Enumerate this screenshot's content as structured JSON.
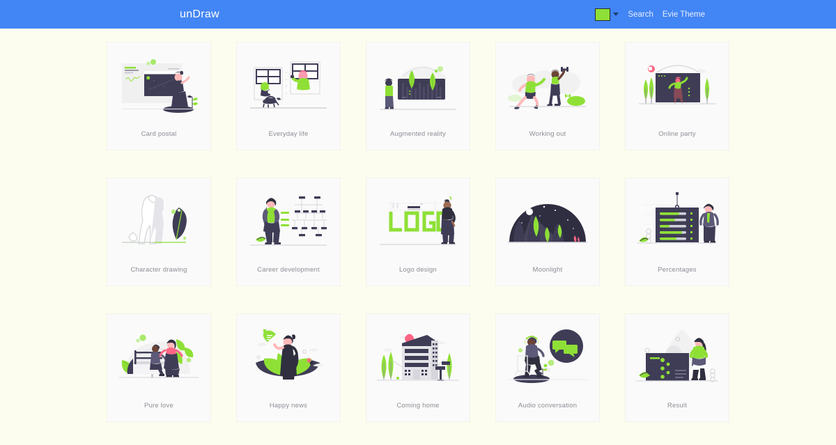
{
  "header": {
    "brand": "unDraw",
    "color_swatch": "#8FE036",
    "caret_icon": "chevron-down-icon",
    "links": [
      {
        "label": "Search",
        "name": "search-link"
      },
      {
        "label": "Evie Theme",
        "name": "evie-theme-link"
      }
    ]
  },
  "theme": {
    "page_background": "#FDFDEF",
    "card_background": "#FAFAFA",
    "accent_green": "#8FE036",
    "dark_navy": "#3F3D56",
    "brand_blue": "#4285F4",
    "label_text": "#8D8D96",
    "skin_light": "#FFB9B9",
    "accent_red": "#FF6584"
  },
  "gallery": {
    "columns": 5,
    "items": [
      {
        "id": "card-postal",
        "label": "Card postal"
      },
      {
        "id": "everyday-life",
        "label": "Everyday life"
      },
      {
        "id": "augmented-reality",
        "label": "Augmented reality"
      },
      {
        "id": "working-out",
        "label": "Working out"
      },
      {
        "id": "online-party",
        "label": "Online party"
      },
      {
        "id": "character-drawing",
        "label": "Character drawing"
      },
      {
        "id": "career-development",
        "label": "Career development"
      },
      {
        "id": "logo-design",
        "label": "Logo design"
      },
      {
        "id": "moonlight",
        "label": "Moonlight"
      },
      {
        "id": "percentages",
        "label": "Percentages"
      },
      {
        "id": "pure-love",
        "label": "Pure love"
      },
      {
        "id": "happy-news",
        "label": "Happy news"
      },
      {
        "id": "coming-home",
        "label": "Coming home"
      },
      {
        "id": "audio-conversation",
        "label": "Audio conversation"
      },
      {
        "id": "result",
        "label": "Result"
      }
    ]
  },
  "logo_design_art": {
    "text": "LOGO"
  }
}
